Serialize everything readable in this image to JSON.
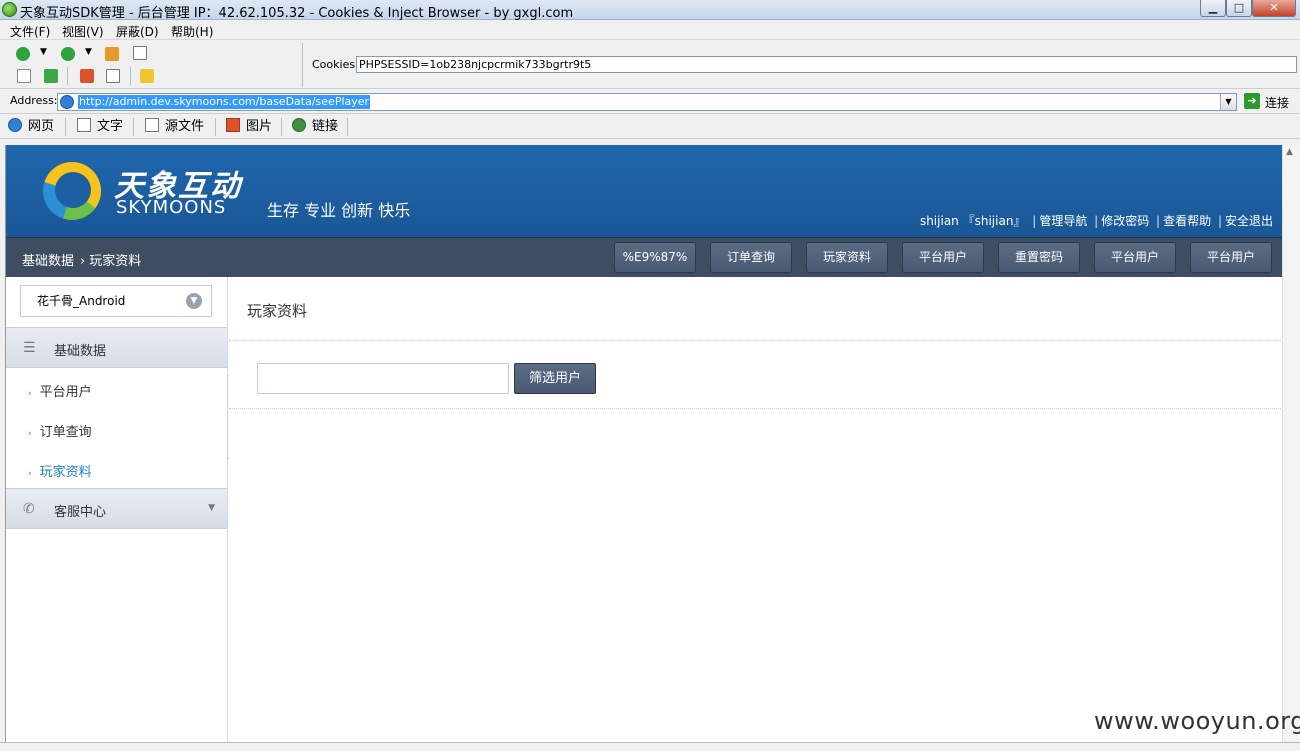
{
  "window": {
    "title": "天象互动SDK管理 - 后台管理 IP：42.62.105.32 - Cookies & Inject Browser - by gxgl.com",
    "min_glyph": "▁",
    "max_glyph": "□",
    "close_glyph": "✕"
  },
  "menu": [
    "文件(F)",
    "视图(V)",
    "屏蔽(D)",
    "帮助(H)"
  ],
  "cookies": {
    "label": "Cookies:",
    "value": "PHPSESSID=1ob238njcpcrmik733bgrtr9t5"
  },
  "address": {
    "label": "Address:",
    "url": "http://admin.dev.skymoons.com/baseData/seePlayer",
    "go_label": "连接"
  },
  "view_tabs": [
    "网页",
    "文字",
    "源文件",
    "图片",
    "链接"
  ],
  "site": {
    "logo_cn": "天象互动",
    "logo_en": "SKYMOONS",
    "slogan": "生存 专业 创新 快乐",
    "user": "shijian",
    "user_bracket": "『shijian』",
    "links": [
      "管理导航",
      "修改密码",
      "查看帮助",
      "安全退出"
    ]
  },
  "nav": {
    "crumb_root": "基础数据",
    "crumb_arrow": "›",
    "crumb_current": "玩家资料",
    "buttons": [
      "%E9%87%",
      "订单查询",
      "玩家资料",
      "平台用户",
      "重置密码",
      "平台用户",
      "平台用户"
    ]
  },
  "sidebar": {
    "game": "花千骨_Android",
    "sections": [
      {
        "label": "基础数据",
        "items": [
          "平台用户",
          "订单查询",
          "玩家资料"
        ],
        "active": "玩家资料"
      },
      {
        "label": "客服中心"
      }
    ]
  },
  "main": {
    "title": "玩家资料",
    "filter_placeholder": "",
    "filter_button": "筛选用户"
  },
  "watermark": "www.wooyun.org"
}
